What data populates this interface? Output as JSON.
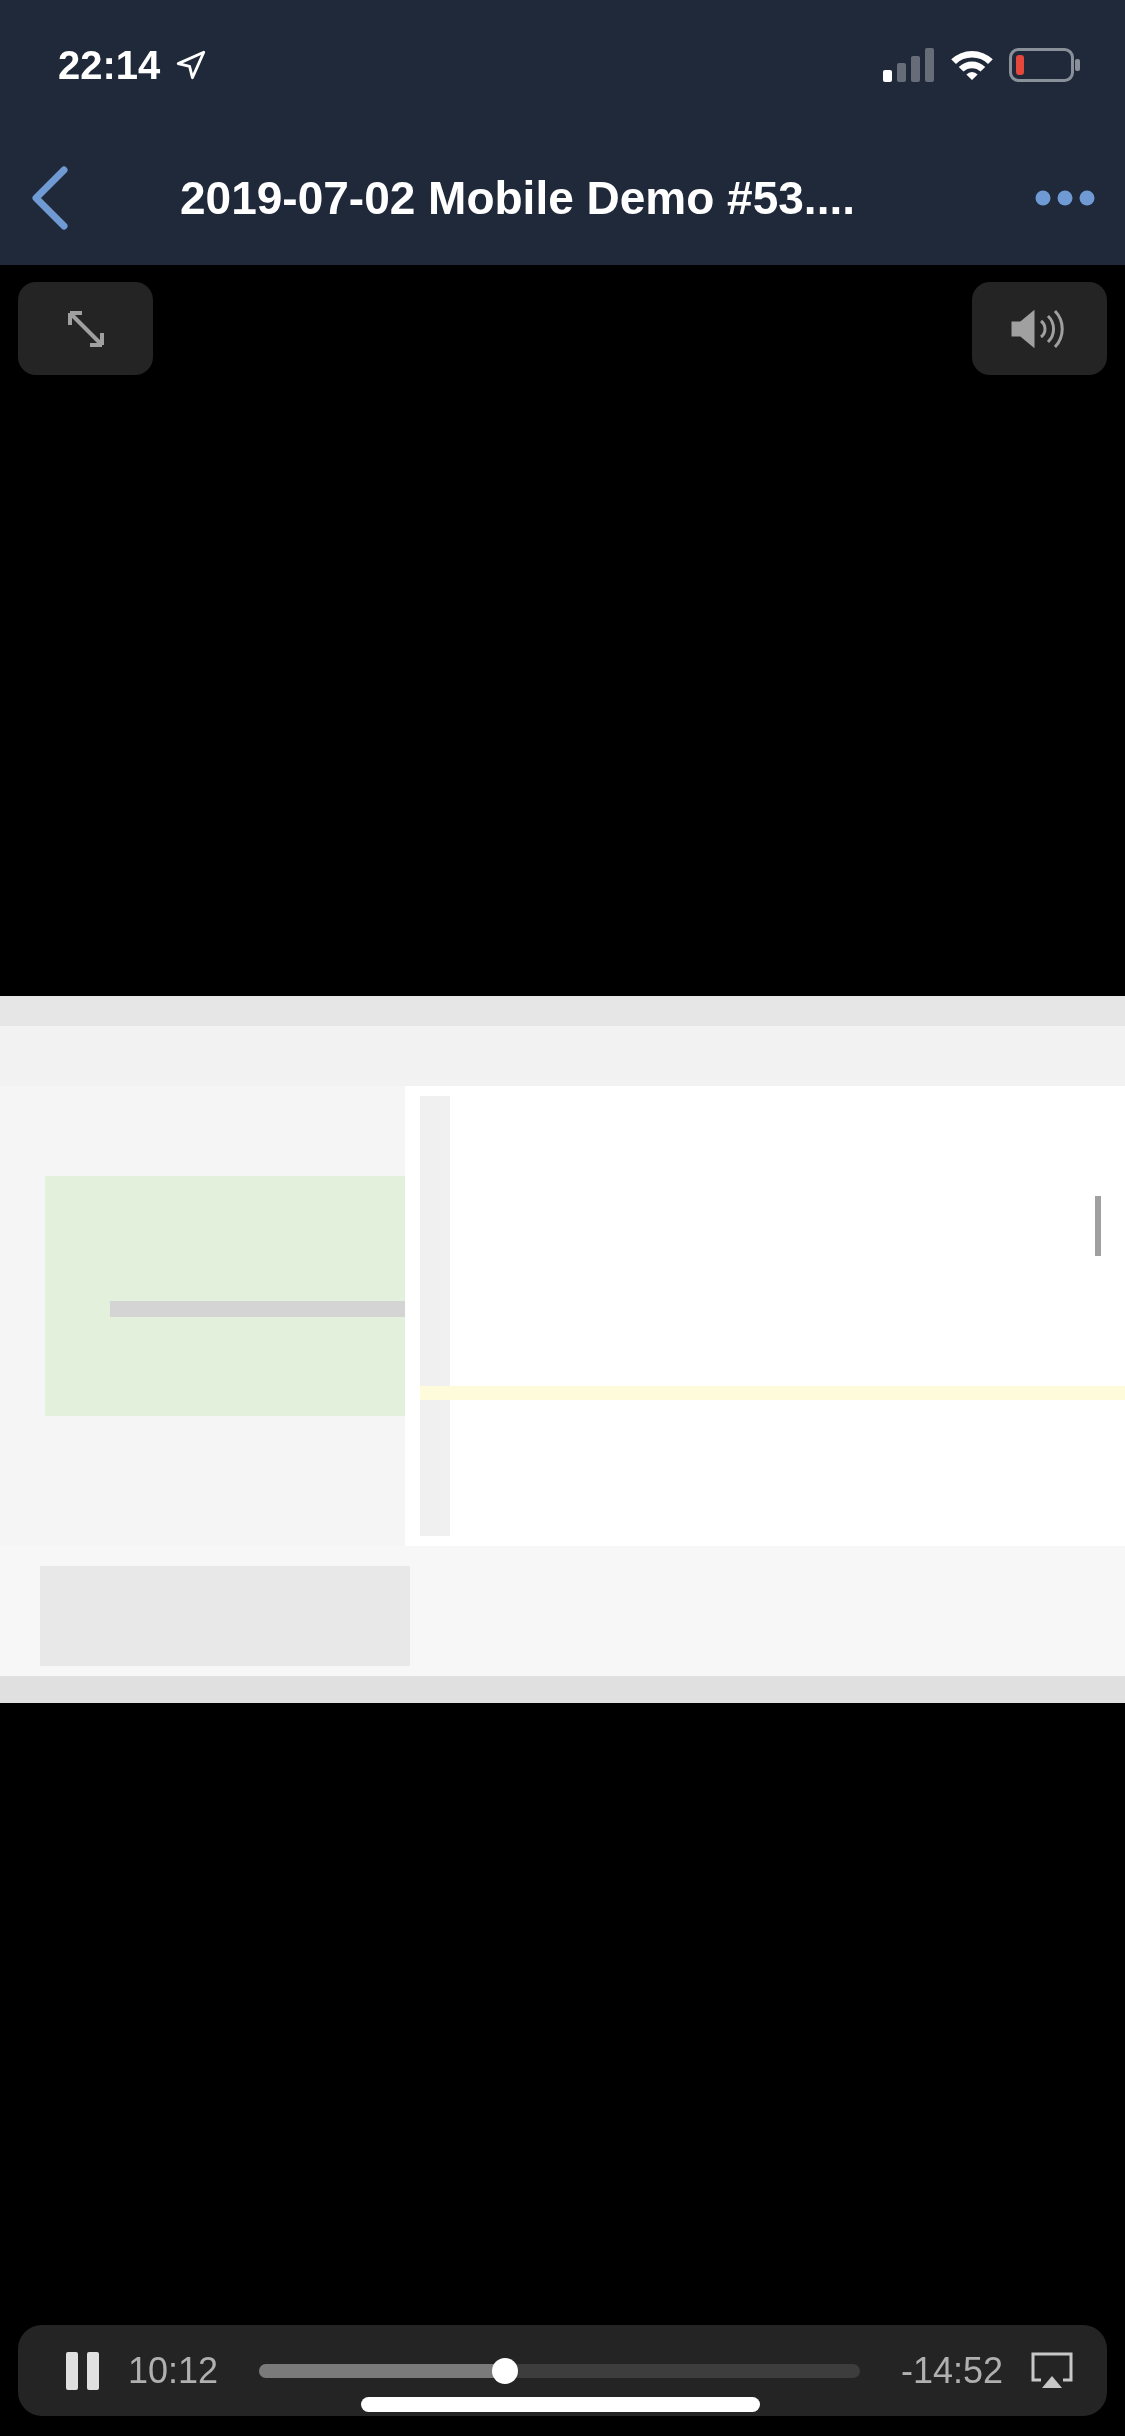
{
  "status_bar": {
    "time": "22:14"
  },
  "nav_bar": {
    "title": "2019-07-02 Mobile Demo #53...."
  },
  "player": {
    "elapsed": "10:12",
    "remaining": "-14:52",
    "playing": true,
    "level": 0.41
  }
}
